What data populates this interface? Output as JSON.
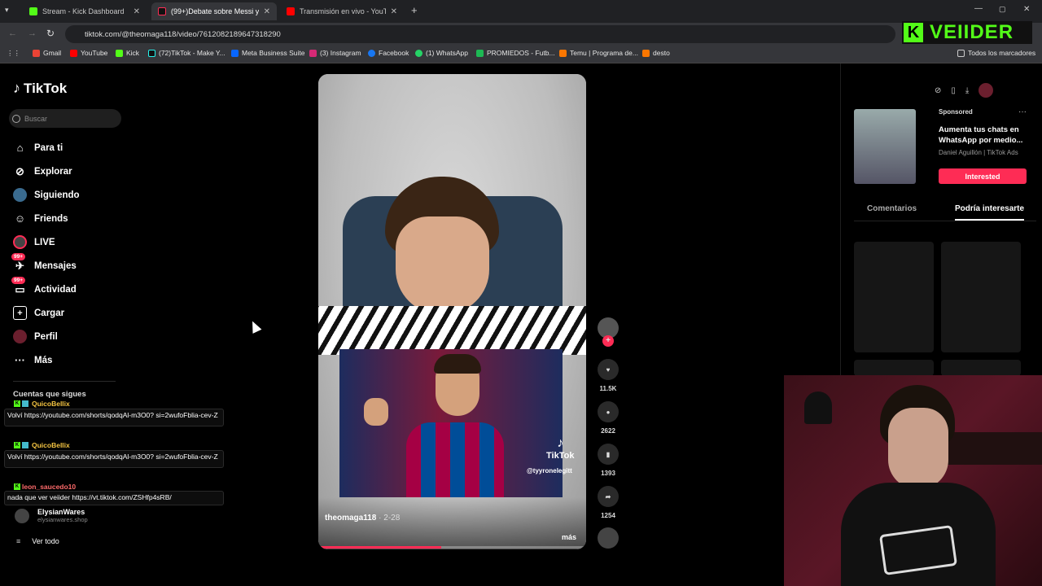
{
  "browser": {
    "tabs": [
      {
        "label": "Stream - Kick Dashboard",
        "color": "#53fc18"
      },
      {
        "label": "(99+)Debate sobre Messi y",
        "color": "#fe2c55"
      },
      {
        "label": "Transmisión en vivo - YouTube",
        "color": "#ff0000"
      }
    ],
    "url": "tiktok.com/@theomaga118/video/7612082189647318290",
    "bookmarks": [
      "Gmail",
      "YouTube",
      "Kick",
      "(72)TikTok - Make Y...",
      "Meta Business Suite",
      "(3) Instagram",
      "Facebook",
      "(1) WhatsApp",
      "PROMIEDOS - Futb...",
      "Temu | Programa de...",
      "desto"
    ],
    "all_bookmarks": "Todos los marcadores"
  },
  "tiktok": {
    "logo": "TikTok",
    "search_placeholder": "Buscar",
    "nav": [
      {
        "label": "Para ti"
      },
      {
        "label": "Explorar"
      },
      {
        "label": "Siguiendo"
      },
      {
        "label": "Friends"
      },
      {
        "label": "LIVE"
      },
      {
        "label": "Mensajes",
        "badge": "99+"
      },
      {
        "label": "Actividad",
        "badge": "99+"
      },
      {
        "label": "Cargar"
      },
      {
        "label": "Perfil"
      },
      {
        "label": "Más"
      }
    ],
    "following_title": "Cuentas que sigues",
    "following": [
      {
        "name": "ElysianWares",
        "sub": "elysianwares.shop"
      }
    ],
    "see_all": "Ver todo",
    "video": {
      "author": "theomaga118",
      "date": "2-28",
      "more": "más",
      "watermark": "TikTok",
      "watermark_user": "@tyyronelegitt",
      "progress": 0.46
    },
    "actions": {
      "likes": "11.5K",
      "comments": "2622",
      "saves": "1393",
      "shares": "1254"
    },
    "ad": {
      "sponsored": "Sponsored",
      "title": "Aumenta tus chats en WhatsApp por medio...",
      "advertiser": "Daniel Aguillón | TikTok Ads",
      "cta": "Interested"
    },
    "tabs": {
      "comments": "Comentarios",
      "suggested": "Podría interesarte"
    }
  },
  "chat": [
    {
      "user": "QuicoBellix",
      "text": "Volví https://youtube.com/shorts/qodqAl-m3O0? si=2wufoFblia-cev-Z"
    },
    {
      "user": "QuicoBellix",
      "text": "Volví https://youtube.com/shorts/qodqAl-m3O0? si=2wufoFblia-cev-Z"
    },
    {
      "user": "leon_saucedo10",
      "text": "nada que ver veiider https://vt.tiktok.com/ZSHfp4sRB/"
    }
  ],
  "overlay": {
    "brand": "VEIIDER",
    "k": "K"
  },
  "colors": {
    "accent": "#fe2c55",
    "kick": "#53fc18"
  }
}
